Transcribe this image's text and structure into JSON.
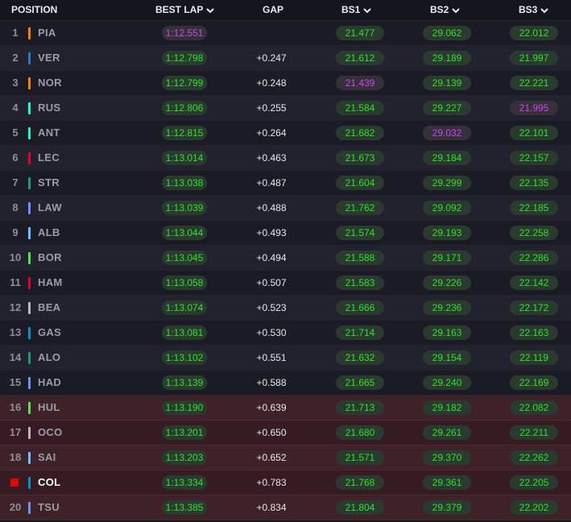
{
  "header": {
    "position": "POSITION",
    "best_lap": "BEST LAP",
    "gap": "GAP",
    "bs1": "BS1",
    "bs2": "BS2",
    "bs3": "BS3"
  },
  "rows": [
    {
      "pos": "1",
      "code": "PIA",
      "team_color": "#ff8000",
      "best_lap": "1:12.551",
      "gap": "",
      "bs1": "21.477",
      "bs2": "29.062",
      "bs3": "22.012",
      "best_lap_purple": true
    },
    {
      "pos": "2",
      "code": "VER",
      "team_color": "#3671c6",
      "best_lap": "1:12.798",
      "gap": "+0.247",
      "bs1": "21.612",
      "bs2": "29.189",
      "bs3": "21.997"
    },
    {
      "pos": "3",
      "code": "NOR",
      "team_color": "#ff8000",
      "best_lap": "1:12.799",
      "gap": "+0.248",
      "bs1": "21.439",
      "bs2": "29.139",
      "bs3": "22.221",
      "bs1_purple": true
    },
    {
      "pos": "4",
      "code": "RUS",
      "team_color": "#27f4d2",
      "best_lap": "1:12.806",
      "gap": "+0.255",
      "bs1": "21.584",
      "bs2": "29.227",
      "bs3": "21.995",
      "bs3_purple": true
    },
    {
      "pos": "5",
      "code": "ANT",
      "team_color": "#27f4d2",
      "best_lap": "1:12.815",
      "gap": "+0.264",
      "bs1": "21.682",
      "bs2": "29.032",
      "bs3": "22.101",
      "bs2_purple": true
    },
    {
      "pos": "6",
      "code": "LEC",
      "team_color": "#e8002d",
      "best_lap": "1:13.014",
      "gap": "+0.463",
      "bs1": "21.673",
      "bs2": "29.184",
      "bs3": "22.157"
    },
    {
      "pos": "7",
      "code": "STR",
      "team_color": "#229971",
      "best_lap": "1:13.038",
      "gap": "+0.487",
      "bs1": "21.604",
      "bs2": "29.299",
      "bs3": "22.135"
    },
    {
      "pos": "8",
      "code": "LAW",
      "team_color": "#6692ff",
      "best_lap": "1:13.039",
      "gap": "+0.488",
      "bs1": "21.762",
      "bs2": "29.092",
      "bs3": "22.185"
    },
    {
      "pos": "9",
      "code": "ALB",
      "team_color": "#64c4ff",
      "best_lap": "1:13.044",
      "gap": "+0.493",
      "bs1": "21.574",
      "bs2": "29.193",
      "bs3": "22.258"
    },
    {
      "pos": "10",
      "code": "BOR",
      "team_color": "#52e252",
      "best_lap": "1:13.045",
      "gap": "+0.494",
      "bs1": "21.588",
      "bs2": "29.171",
      "bs3": "22.286"
    },
    {
      "pos": "11",
      "code": "HAM",
      "team_color": "#e8002d",
      "best_lap": "1:13.058",
      "gap": "+0.507",
      "bs1": "21.583",
      "bs2": "29.226",
      "bs3": "22.142"
    },
    {
      "pos": "12",
      "code": "BEA",
      "team_color": "#b6babd",
      "best_lap": "1:13.074",
      "gap": "+0.523",
      "bs1": "21.666",
      "bs2": "29.236",
      "bs3": "22.172"
    },
    {
      "pos": "13",
      "code": "GAS",
      "team_color": "#0093cc",
      "best_lap": "1:13.081",
      "gap": "+0.530",
      "bs1": "21.714",
      "bs2": "29.163",
      "bs3": "22.163"
    },
    {
      "pos": "14",
      "code": "ALO",
      "team_color": "#229971",
      "best_lap": "1:13.102",
      "gap": "+0.551",
      "bs1": "21.632",
      "bs2": "29.154",
      "bs3": "22.119"
    },
    {
      "pos": "15",
      "code": "HAD",
      "team_color": "#6692ff",
      "best_lap": "1:13.139",
      "gap": "+0.588",
      "bs1": "21.665",
      "bs2": "29.240",
      "bs3": "22.169"
    },
    {
      "pos": "16",
      "code": "HUL",
      "team_color": "#52e252",
      "best_lap": "1:13.190",
      "gap": "+0.639",
      "bs1": "21.713",
      "bs2": "29.182",
      "bs3": "22.082",
      "eliminated": true
    },
    {
      "pos": "17",
      "code": "OCO",
      "team_color": "#b6babd",
      "best_lap": "1:13.201",
      "gap": "+0.650",
      "bs1": "21.680",
      "bs2": "29.261",
      "bs3": "22.211",
      "eliminated": true
    },
    {
      "pos": "18",
      "code": "SAI",
      "team_color": "#64c4ff",
      "best_lap": "1:13.203",
      "gap": "+0.652",
      "bs1": "21.571",
      "bs2": "29.370",
      "bs3": "22.262",
      "eliminated": true
    },
    {
      "pos": "",
      "code": "COL",
      "team_color": "#0093cc",
      "best_lap": "1:13.334",
      "gap": "+0.783",
      "bs1": "21.768",
      "bs2": "29.361",
      "bs3": "22.205",
      "eliminated": true,
      "highlight": true
    },
    {
      "pos": "20",
      "code": "TSU",
      "team_color": "#6692ff",
      "best_lap": "1:13.385",
      "gap": "+0.834",
      "bs1": "21.804",
      "bs2": "29.379",
      "bs3": "22.202",
      "eliminated": true
    }
  ]
}
